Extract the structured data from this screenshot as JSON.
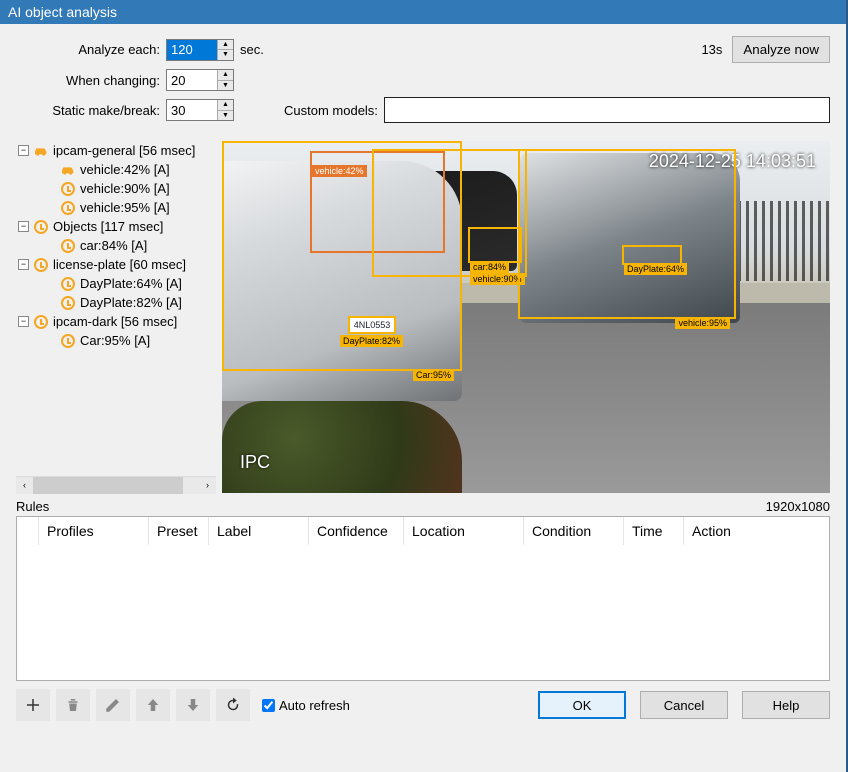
{
  "window": {
    "title": "AI object analysis"
  },
  "form": {
    "analyze_each_label": "Analyze each:",
    "analyze_each_value": "120",
    "analyze_each_unit": "sec.",
    "when_changing_label": "When changing:",
    "when_changing_value": "20",
    "static_label": "Static make/break:",
    "static_value": "30",
    "custom_models_label": "Custom models:",
    "custom_models_value": "",
    "status_time": "13s",
    "analyze_now": "Analyze now"
  },
  "tree": {
    "nodes": [
      {
        "label": "ipcam-general [56 msec]",
        "icon": "car",
        "children": [
          {
            "label": "vehicle:42% [A]",
            "icon": "car"
          },
          {
            "label": "vehicle:90% [A]",
            "icon": "stopwatch"
          },
          {
            "label": "vehicle:95% [A]",
            "icon": "stopwatch"
          }
        ]
      },
      {
        "label": "Objects [117 msec]",
        "icon": "stopwatch",
        "children": [
          {
            "label": "car:84% [A]",
            "icon": "stopwatch"
          }
        ]
      },
      {
        "label": "license-plate [60 msec]",
        "icon": "stopwatch",
        "children": [
          {
            "label": "DayPlate:64% [A]",
            "icon": "stopwatch"
          },
          {
            "label": "DayPlate:82% [A]",
            "icon": "stopwatch"
          }
        ]
      },
      {
        "label": "ipcam-dark [56 msec]",
        "icon": "stopwatch",
        "children": [
          {
            "label": "Car:95% [A]",
            "icon": "stopwatch"
          }
        ]
      }
    ]
  },
  "preview": {
    "timestamp": "2024-12-25 14:03:51",
    "camera_name": "IPC",
    "boxes": {
      "vehicle42": "vehicle:42%",
      "car84": "car:84%",
      "vehicle90": "vehicle:90%",
      "dayplate64": "DayPlate:64%",
      "vehicle95": "vehicle:95%",
      "dayplate82": "DayPlate:82%",
      "car95": "Car:95%",
      "plate_text": "4NL0553"
    }
  },
  "rules": {
    "label": "Rules",
    "resolution": "1920x1080",
    "columns": {
      "profiles": "Profiles",
      "preset": "Preset",
      "label_col": "Label",
      "confidence": "Confidence",
      "location": "Location",
      "condition": "Condition",
      "time": "Time",
      "action": "Action"
    }
  },
  "toolbar": {
    "auto_refresh": "Auto refresh",
    "ok": "OK",
    "cancel": "Cancel",
    "help": "Help"
  }
}
